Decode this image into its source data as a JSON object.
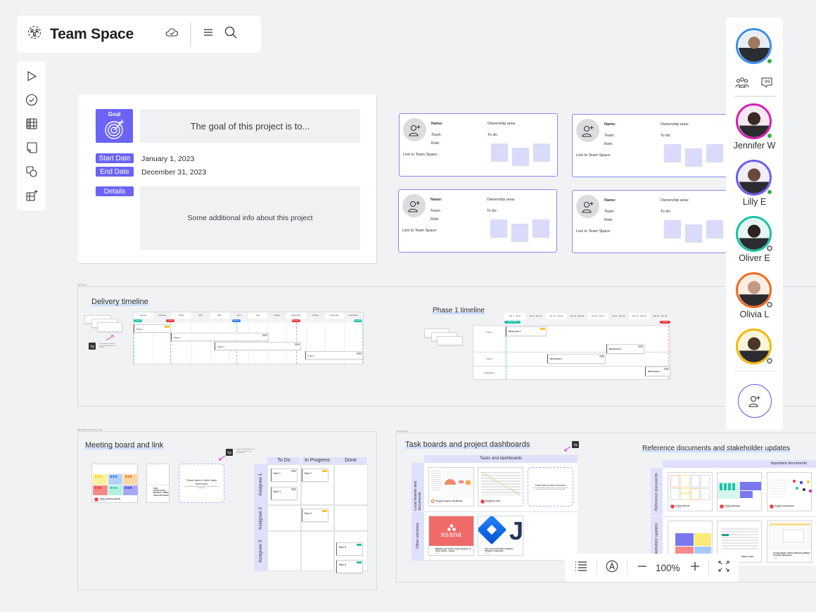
{
  "header": {
    "title": "Team Space",
    "icons": [
      "team-space-logo-icon",
      "cloud-saved-icon",
      "menu-icon",
      "search-icon"
    ]
  },
  "toolbar": {
    "tools": [
      {
        "name": "select-tool",
        "icon": "cursor-arrow-icon"
      },
      {
        "name": "task-tool",
        "icon": "check-circle-icon"
      },
      {
        "name": "table-tool",
        "icon": "table-grid-icon"
      },
      {
        "name": "sticky-note-tool",
        "icon": "sticky-note-icon"
      },
      {
        "name": "shapes-tool",
        "icon": "shapes-icon"
      },
      {
        "name": "add-container-tool",
        "icon": "container-plus-icon"
      }
    ]
  },
  "project": {
    "goal_label": "Goal",
    "goal_text": "The goal of this project is to...",
    "start_label": "Start Date",
    "start_value": "January 1, 2023",
    "end_label": "End Date",
    "end_value": "December 31, 2023",
    "details_label": "Details",
    "details_text": "Some additional info about this project"
  },
  "team_card": {
    "name": "Name:",
    "team": "Team:",
    "role": "Role:",
    "link": "Link to Team Space:",
    "ownership": "Ownership area:",
    "todo": "To do:"
  },
  "delivery": {
    "frame_label": "Delivery",
    "title": "Delivery timeline",
    "months": [
      "January",
      "February",
      "March",
      "April",
      "May",
      "June",
      "July",
      "August",
      "September",
      "October",
      "November",
      "December"
    ],
    "markers": [
      {
        "label": "Project START",
        "color": "#20c3a7"
      },
      {
        "label": "Deadline",
        "color": "#e8333b"
      },
      {
        "label": "Milestone",
        "color": "#2a7de1"
      },
      {
        "label": "Deadline",
        "color": "#e8333b"
      },
      {
        "label": "Project END",
        "color": "#20c3a7"
      }
    ],
    "phases": [
      "Phase 1",
      "Phase 2",
      "Phase 3",
      "Phase 4"
    ],
    "tip": "Tip",
    "tip_text": "Create swaps using these cards and drag them to the timeline"
  },
  "phase1": {
    "title": "Phase 1 timeline",
    "weeks": [
      "Jan 1 - Jan 8",
      "Jan 9 - Jan 15",
      "Jan 16 - Jan 22",
      "Jan 23 - Jan 29",
      "Jan 30 - Feb 5",
      "Feb 6 - Feb 12",
      "Feb 13 - Feb 19",
      "Feb 20 - Feb 26"
    ],
    "start_marker": "Project START",
    "end_marker": "Deadline",
    "rows": [
      "Team 1",
      "Team 2",
      "Unassigned"
    ],
    "workstreams": [
      "Workstream 1",
      "Workstream 2",
      "Workstream 3",
      "Workstream 4"
    ]
  },
  "meeting": {
    "frame_label": "Meeting board and link",
    "title": "Meeting board and link",
    "board_caption": "Team meeting agenda",
    "board_sub": "Lucidspark",
    "video_caption": "Video Conferencing, Meetings, Calling | Microsoft Teams",
    "paste_title": "Paste links to other daily resources",
    "paste_sub": "Use the toolbar to add a quick link, recent document, or Slack board",
    "tip": "Tip",
    "tip_text": "Using the toolbar add a quick link, recent document, or Slack board"
  },
  "kanban": {
    "columns": [
      "To Do",
      "In Progress",
      "Done"
    ],
    "rows": [
      "Assignee 1",
      "Assignee 2",
      "Assignee 3"
    ],
    "tasks": [
      "Task 1",
      "Task 2",
      "Task 3",
      "Task 4",
      "Task 5",
      "Task 6"
    ]
  },
  "dashboards": {
    "frame_label": "Documents",
    "title": "Task boards and project dashboards",
    "header": "Tasks and dashboards",
    "row1": "Lucid boards and documents",
    "row2": "Other solutions",
    "items": [
      {
        "caption": "Project progress dashboard",
        "sub": "Lucidchart"
      },
      {
        "caption": "Burndown chart",
        "sub": "Lucidspark"
      },
      {
        "caption": "Manage your team's work, projects, & tasks online • Asana",
        "sub": "Asana"
      },
      {
        "caption": "Jira | Issue & Project Tracking Software | Atlassian",
        "sub": "Atlassian"
      }
    ],
    "asana_logo": "asana",
    "paste_title": "Paste links to other resources",
    "paste_sub": "Use the left toolbar to add a quick link, recent document, or Slack board and drag them into the Dynamic table",
    "tip": "Tip"
  },
  "references": {
    "title": "Reference documents and stakeholder updates",
    "header": "Important documents",
    "row1": "Reference documents",
    "row2": "Stakeholder updates",
    "items": [
      {
        "caption": "Project kick-off",
        "sub": "Lucidspark"
      },
      {
        "caption": "Project planning",
        "sub": "Lucidspark"
      },
      {
        "caption": "Project retrospective",
        "sub": "Lucidspark"
      },
      {
        "caption": "Status report",
        "sub": ""
      },
      {
        "caption": "Google Slides: Online Slideshow Maker | Google Workspace",
        "sub": "Google"
      }
    ]
  },
  "collaborators": {
    "current_user": {
      "ring": "#3b8ef3",
      "status": "online"
    },
    "users": [
      {
        "name": "Jennifer W",
        "ring": "#d61fb2",
        "status": "online"
      },
      {
        "name": "Lilly E",
        "ring": "#6b5cf0",
        "status": "online"
      },
      {
        "name": "Oliver E",
        "ring": "#19c2a2",
        "status": "away"
      },
      {
        "name": "Olivia L",
        "ring": "#f26a1b",
        "status": "away"
      },
      {
        "name": "",
        "ring": "#f2b705",
        "status": "away"
      }
    ]
  },
  "zoom": {
    "level": "100%"
  },
  "colors": {
    "accent": "#6b63f6",
    "sticky": "#dadbfa",
    "card_border": "#8b87f0"
  }
}
